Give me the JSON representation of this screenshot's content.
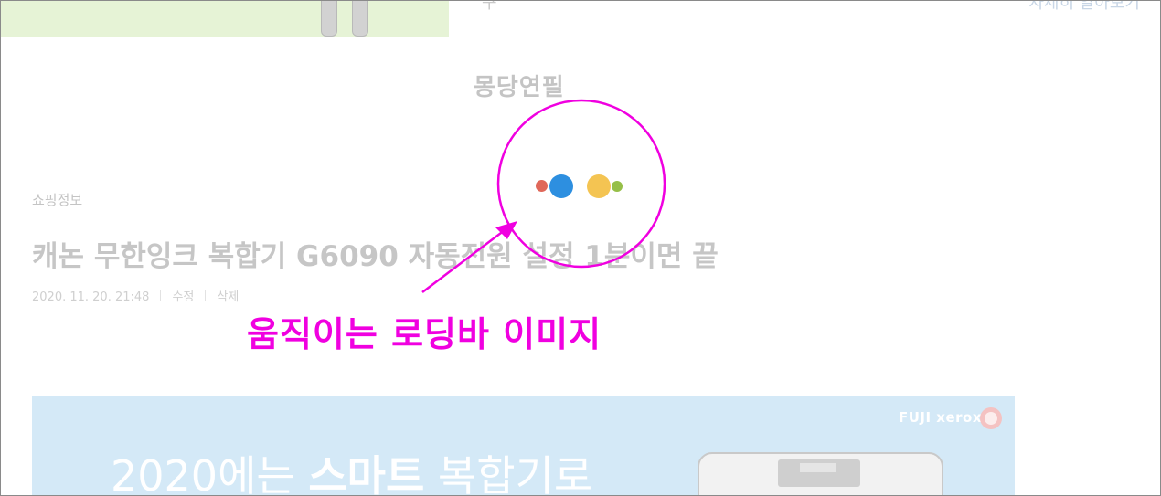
{
  "header": {
    "left_fragment_text": "구 ",
    "right_link_text": "자세히 알아보기"
  },
  "blog": {
    "title": "몽당연필"
  },
  "post": {
    "category": "쇼핑정보",
    "title": "캐논 무한잉크 복합기 G6090 자동전원 설정 1분이면 끝",
    "date": "2020. 11. 20. 21:48",
    "edit_label": "수정",
    "delete_label": "삭제"
  },
  "annotation": {
    "text": "움직이는 로딩바 이미지",
    "color": "#f000e0"
  },
  "loader": {
    "dot_colors": [
      "#e0685a",
      "#2d8fe0",
      "#f4c452",
      "#96bf48"
    ]
  },
  "ad": {
    "brand": "FUJI xerox",
    "headline_prefix": "2020에는 ",
    "headline_bold": "스마트",
    "headline_suffix": " 복합기로"
  }
}
